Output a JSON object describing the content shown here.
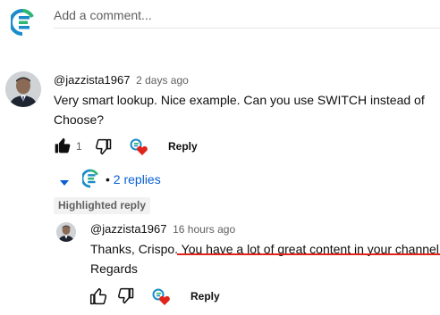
{
  "add_comment": {
    "placeholder": "Add a comment..."
  },
  "comment": {
    "author": "@jazzista1967",
    "time": "2 days ago",
    "text_line1": "Very smart lookup. Nice example. Can you use SWITCH instead of",
    "text_line2": "Choose?",
    "like_count": "1",
    "reply_label": "Reply"
  },
  "replies_toggle": {
    "label": "2 replies"
  },
  "highlighted_label": "Highlighted reply",
  "reply": {
    "author": "@jazzista1967",
    "time": "16 hours ago",
    "text_plain": "Thanks, Crispo. ",
    "text_underlined": "You have a lot of great content in your channel.",
    "text_line2": "Regards",
    "reply_label": "Reply"
  },
  "colors": {
    "link_blue": "#065fd4",
    "heart_red": "#e0241b",
    "logo_blue": "#1a8cc9",
    "logo_green": "#2bb673"
  },
  "icons": [
    "channel-logo-icon",
    "thumbs-up-icon",
    "thumbs-down-icon",
    "creator-heart-icon",
    "caret-down-icon"
  ]
}
